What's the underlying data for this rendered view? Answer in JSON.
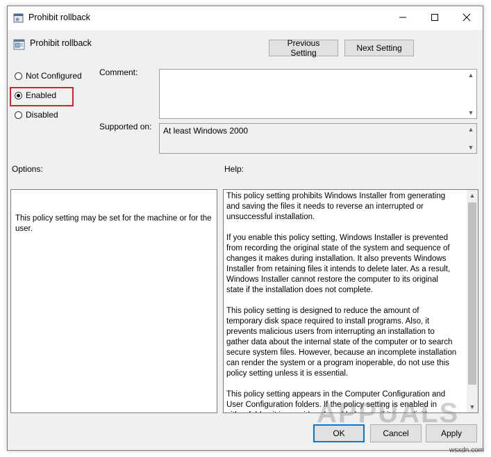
{
  "window": {
    "title": "Prohibit rollback"
  },
  "header": {
    "title": "Prohibit rollback"
  },
  "nav": {
    "previous_label": "Previous Setting",
    "next_label": "Next Setting"
  },
  "state": {
    "options": [
      {
        "label": "Not Configured",
        "checked": false
      },
      {
        "label": "Enabled",
        "checked": true
      },
      {
        "label": "Disabled",
        "checked": false
      }
    ]
  },
  "comment": {
    "label": "Comment:",
    "value": ""
  },
  "supported": {
    "label": "Supported on:",
    "value": "At least Windows 2000"
  },
  "options_panel": {
    "label": "Options:",
    "text": "This policy setting may be set for the machine or for the user."
  },
  "help_panel": {
    "label": "Help:",
    "paragraphs": [
      "This policy setting prohibits Windows Installer from generating and saving the files it needs to reverse an interrupted or unsuccessful installation.",
      "If you enable this policy setting, Windows Installer is prevented from recording the original state of the system and sequence of changes it makes during installation. It also prevents Windows Installer from retaining files it intends to delete later. As a result, Windows Installer cannot restore the computer to its original state if the installation does not complete.",
      "This policy setting is designed to reduce the amount of temporary disk space required to install programs. Also, it prevents malicious users from interrupting an installation to gather data about the internal state of the computer or to search secure system files. However, because an incomplete installation can render the system or a program inoperable, do not use this policy setting unless it is essential.",
      "This policy setting appears in the Computer Configuration and User Configuration folders. If the policy setting is enabled in either folder, it is considered enabled, even if it is explicitly disabled in the other folder."
    ]
  },
  "footer": {
    "ok_label": "OK",
    "cancel_label": "Cancel",
    "apply_label": "Apply"
  },
  "watermark": {
    "text": "APPUALS",
    "site": "wsxdn.com"
  },
  "colors": {
    "accent": "#0078d7",
    "highlight": "#d9202a"
  }
}
